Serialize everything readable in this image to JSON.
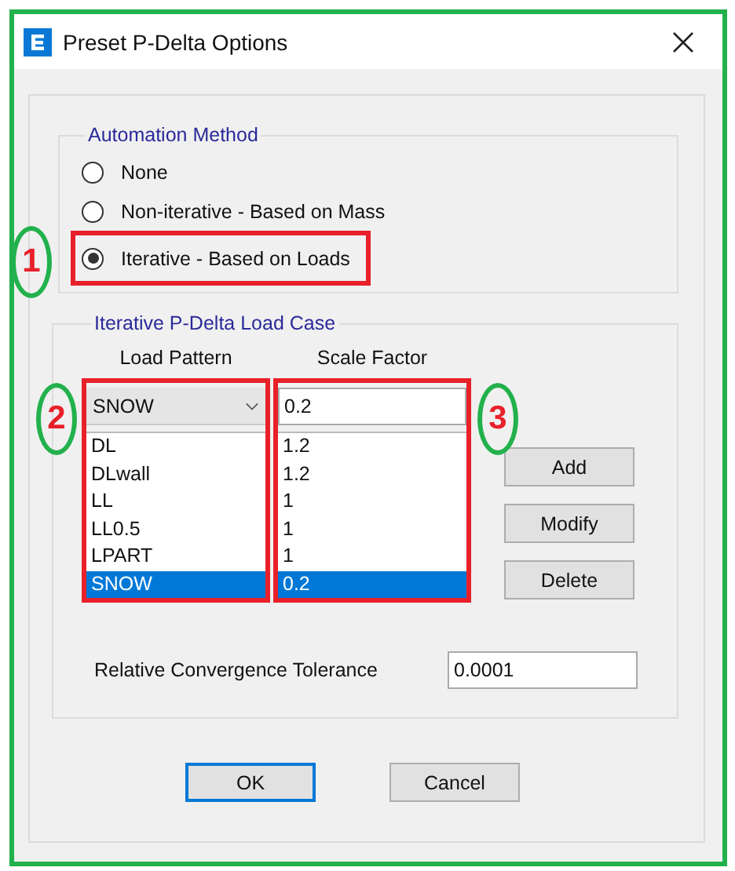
{
  "window": {
    "title": "Preset P-Delta Options"
  },
  "automation_method": {
    "label": "Automation Method",
    "options": [
      {
        "label": "None",
        "selected": false,
        "highlighted": false
      },
      {
        "label": "Non-iterative - Based on Mass",
        "selected": false,
        "highlighted": false
      },
      {
        "label": "Iterative - Based on Loads",
        "selected": true,
        "highlighted": true,
        "marker": "1"
      }
    ]
  },
  "load_case": {
    "label": "Iterative P-Delta Load Case",
    "columns": [
      {
        "header": "Load Pattern",
        "kind": "dropdown",
        "value": "SNOW",
        "highlighted": true,
        "marker": "2"
      },
      {
        "header": "Scale Factor",
        "kind": "input",
        "value": "0.2",
        "highlighted": true,
        "marker": "3"
      }
    ],
    "rows": [
      {
        "cells": [
          "DL",
          "1.2"
        ],
        "selected": false
      },
      {
        "cells": [
          "DLwall",
          "1.2"
        ],
        "selected": false
      },
      {
        "cells": [
          "LL",
          "1"
        ],
        "selected": false
      },
      {
        "cells": [
          "LL0.5",
          "1"
        ],
        "selected": false
      },
      {
        "cells": [
          "LPART",
          "1"
        ],
        "selected": false
      },
      {
        "cells": [
          "SNOW",
          "0.2"
        ],
        "selected": true
      }
    ],
    "buttons": [
      "Add",
      "Modify",
      "Delete"
    ]
  },
  "tolerance": {
    "label": "Relative Convergence Tolerance",
    "value": "0.0001"
  },
  "buttons": [
    {
      "label": "OK",
      "default": true
    },
    {
      "label": "Cancel",
      "default": false
    }
  ]
}
